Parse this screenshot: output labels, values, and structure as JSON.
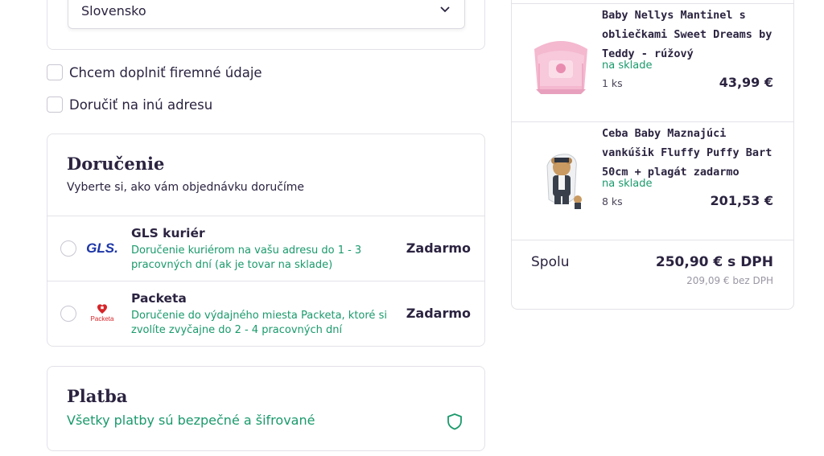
{
  "address": {
    "country_value": "Slovensko"
  },
  "options": {
    "company_label": "Chcem doplniť firemné údaje",
    "other_address_label": "Doručiť na inú adresu"
  },
  "delivery": {
    "title": "Doručenie",
    "subtitle": "Vyberte si, ako vám objednávku doručíme",
    "methods": [
      {
        "name": "GLS kuriér",
        "logo": "GLS.",
        "description": "Doručenie kuriérom na vašu adresu do 1 - 3 pracovných dní (ak je tovar na sklade)",
        "price": "Zadarmo"
      },
      {
        "name": "Packeta",
        "logo": "Packeta",
        "description": "Doručenie do výdajného miesta Packeta, ktoré si zvolíte zvyčajne do 2 - 4 pracovných dní",
        "price": "Zadarmo"
      }
    ]
  },
  "payment": {
    "title": "Platba",
    "secure_note": "Všetky platby sú bezpečné a šifrované"
  },
  "summary": {
    "items": [
      {
        "name": "Baby Nellys Mantinel s obliečkami Sweet Dreams by Teddy - rúžový",
        "stock": "na sklade",
        "qty": "1 ks",
        "price": "43,99 €"
      },
      {
        "name": "Ceba Baby Maznajúci vankúšik Fluffy Puffy Bart 50cm + plagát zadarmo",
        "stock": "na sklade",
        "qty": "8 ks",
        "price": "201,53 €"
      }
    ],
    "total_label": "Spolu",
    "total_vat": "250,90 € s DPH",
    "total_novat": "209,09 € bez DPH"
  },
  "colors": {
    "accent_green": "#1a9a6c",
    "text_dark": "#2b2340",
    "border": "#e3e1e8",
    "gls_blue": "#1d36a8",
    "gls_yellow": "#f5c400",
    "packeta_red": "#d6262a"
  }
}
